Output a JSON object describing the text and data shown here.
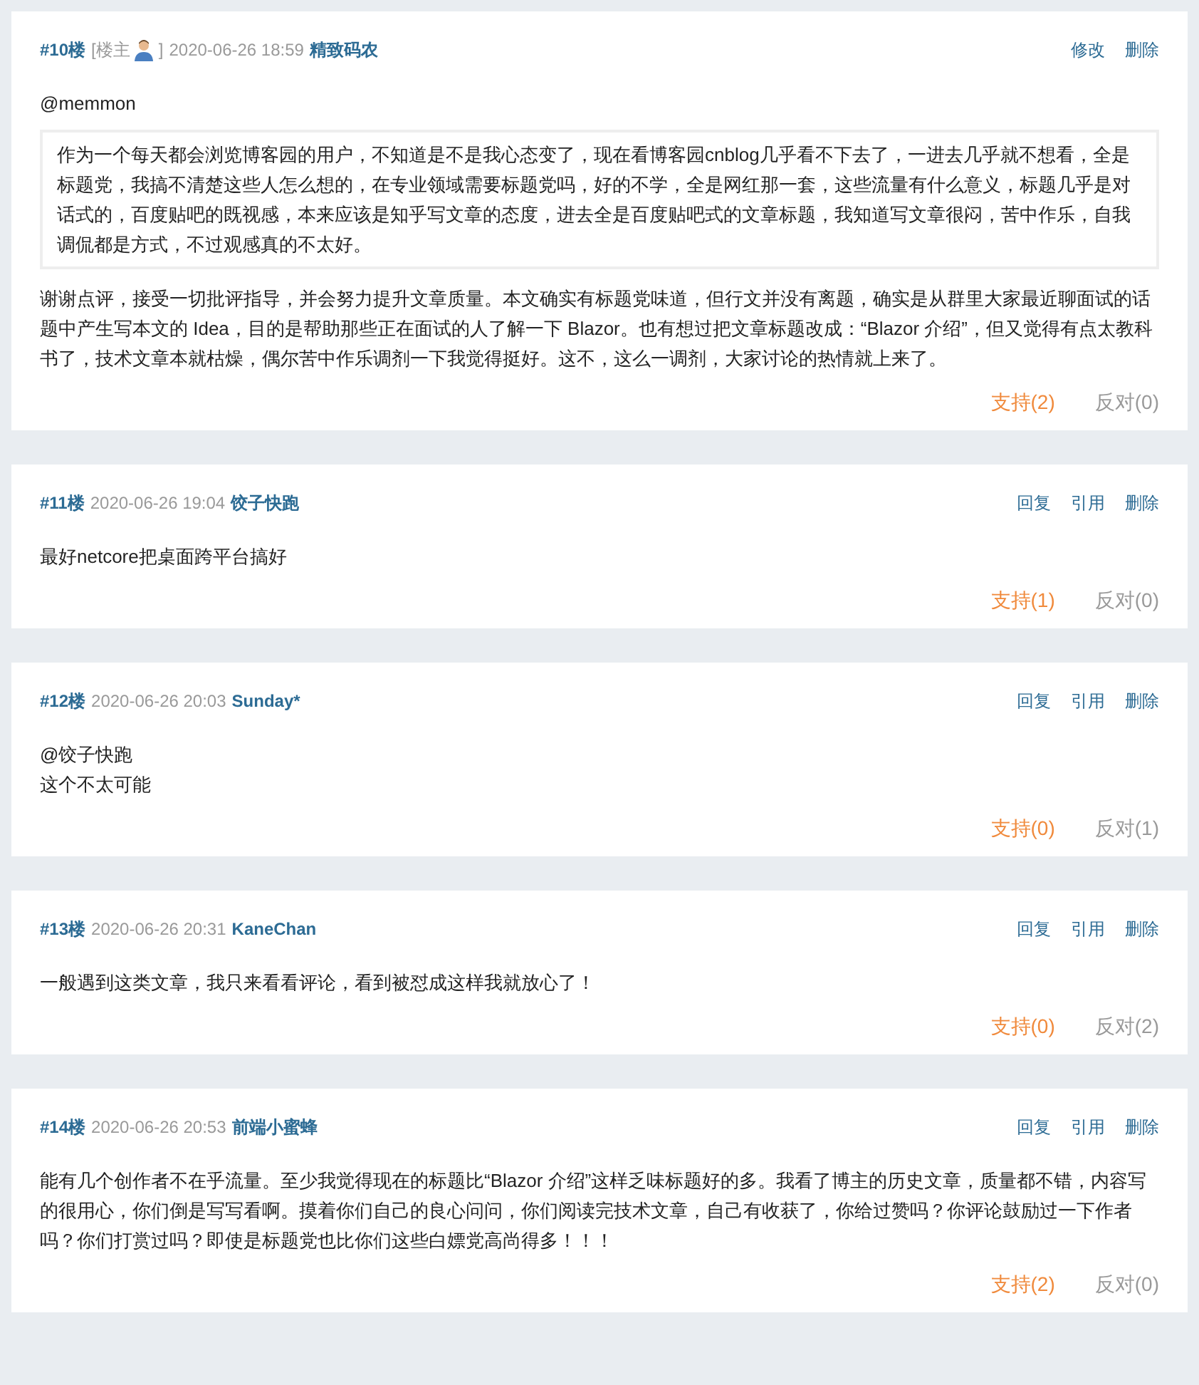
{
  "comments": [
    {
      "floor": "#10楼",
      "owner_tag": {
        "open": "[楼主",
        "close": "]"
      },
      "date": "2020-06-26 18:59",
      "author": "精致码农",
      "actions": [
        "修改",
        "删除"
      ],
      "body": [
        {
          "kind": "text",
          "text": "@memmon"
        },
        {
          "kind": "quote",
          "text": "作为一个每天都会浏览博客园的用户，不知道是不是我心态变了，现在看博客园cnblog几乎看不下去了，一进去几乎就不想看，全是标题党，我搞不清楚这些人怎么想的，在专业领域需要标题党吗，好的不学，全是网红那一套，这些流量有什么意义，标题几乎是对话式的，百度贴吧的既视感，本来应该是知乎写文章的态度，进去全是百度贴吧式的文章标题，我知道写文章很闷，苦中作乐，自我调侃都是方式，不过观感真的不太好。"
        },
        {
          "kind": "text",
          "text": "谢谢点评，接受一切批评指导，并会努力提升文章质量。本文确实有标题党味道，但行文并没有离题，确实是从群里大家最近聊面试的话题中产生写本文的 Idea，目的是帮助那些正在面试的人了解一下 Blazor。也有想过把文章标题改成：“Blazor 介绍”，但又觉得有点太教科书了，技术文章本就枯燥，偶尔苦中作乐调剂一下我觉得挺好。这不，这么一调剂，大家讨论的热情就上来了。"
        }
      ],
      "support": "支持(2)",
      "oppose": "反对(0)"
    },
    {
      "floor": "#11楼",
      "date": "2020-06-26 19:04",
      "author": "饺子快跑",
      "actions": [
        "回复",
        "引用",
        "删除"
      ],
      "body": [
        {
          "kind": "text",
          "text": "最好netcore把桌面跨平台搞好"
        }
      ],
      "support": "支持(1)",
      "oppose": "反对(0)"
    },
    {
      "floor": "#12楼",
      "date": "2020-06-26 20:03",
      "author": "Sunday*",
      "actions": [
        "回复",
        "引用",
        "删除"
      ],
      "body": [
        {
          "kind": "text",
          "text": "@饺子快跑"
        },
        {
          "kind": "text",
          "text": "这个不太可能"
        }
      ],
      "support": "支持(0)",
      "oppose": "反对(1)"
    },
    {
      "floor": "#13楼",
      "date": "2020-06-26 20:31",
      "author": "KaneChan",
      "actions": [
        "回复",
        "引用",
        "删除"
      ],
      "body": [
        {
          "kind": "text",
          "text": "一般遇到这类文章，我只来看看评论，看到被怼成这样我就放心了！"
        }
      ],
      "support": "支持(0)",
      "oppose": "反对(2)"
    },
    {
      "floor": "#14楼",
      "date": "2020-06-26 20:53",
      "author": "前端小蜜蜂",
      "actions": [
        "回复",
        "引用",
        "删除"
      ],
      "body": [
        {
          "kind": "text",
          "text": "能有几个创作者不在乎流量。至少我觉得现在的标题比“Blazor 介绍”这样乏味标题好的多。我看了博主的历史文章，质量都不错，内容写的很用心，你们倒是写写看啊。摸着你们自己的良心问问，你们阅读完技术文章，自己有收获了，你给过赞吗？你评论鼓励过一下作者吗？你们打赏过吗？即使是标题党也比你们这些白嫖党高尚得多！！！"
        }
      ],
      "support": "支持(2)",
      "oppose": "反对(0)"
    }
  ]
}
